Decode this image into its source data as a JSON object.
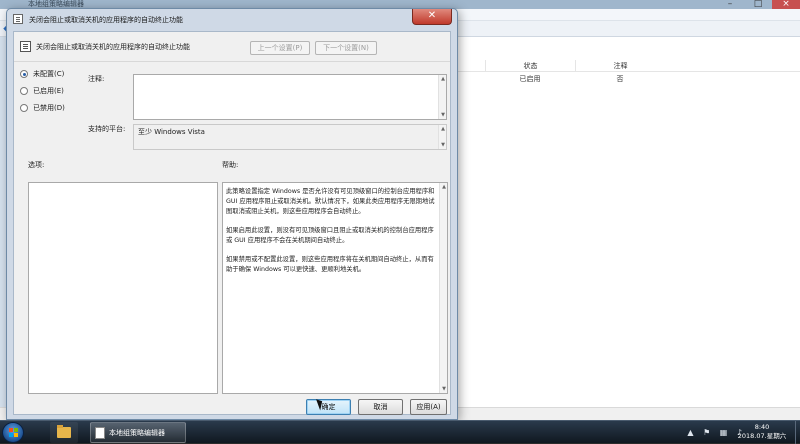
{
  "background_window": {
    "title": "本地组策略编辑器",
    "list_headers": [
      "状态",
      "注释"
    ],
    "list_row": {
      "state": "已启用",
      "comment": "否"
    }
  },
  "dialog": {
    "title": "关闭会阻止或取消关机的应用程序的自动终止功能",
    "policy_name": "关闭会阻止或取消关机的应用程序的自动终止功能",
    "prev_setting": "上一个设置(P)",
    "next_setting": "下一个设置(N)",
    "radio_options": [
      {
        "label": "未配置(C)",
        "checked": true
      },
      {
        "label": "已启用(E)",
        "checked": false
      },
      {
        "label": "已禁用(D)",
        "checked": false
      }
    ],
    "comment_label": "注释:",
    "comment_value": "",
    "supported_on_label": "支持的平台:",
    "supported_on_value": "至少 Windows Vista",
    "options_label": "选项:",
    "help_label": "帮助:",
    "help_paragraphs": [
      "此策略设置指定 Windows 是否允许没有可见顶级窗口的控制台应用程序和 GUI 应用程序阻止或取消关机。默认情况下，如果此类应用程序无限期地试图取消或阻止关机，则这些应用程序会自动终止。",
      "如果启用此设置，则没有可见顶级窗口且阻止或取消关机的控制台应用程序或 GUI 应用程序不会在关机期间自动终止。",
      "如果禁用或不配置此设置，则这些应用程序将在关机期间自动终止，从而有助于确保 Windows 可以更快速、更顺利地关机。"
    ],
    "ok_button": "确定",
    "cancel_button": "取消",
    "apply_button": "应用(A)"
  },
  "taskbar": {
    "active_app_label": "本地组策略编辑器",
    "time": "8:40",
    "date": "2018.07.星期六"
  },
  "colors": {
    "dialog_frame": "#cfd9e6",
    "client_bg": "#f0f0f0",
    "close_button": "#c0392b",
    "taskbar": "#101820"
  },
  "icons": [
    "back-arrow-icon",
    "policy-icon",
    "close-icon",
    "start-orb-icon",
    "folder-icon",
    "volume-icon",
    "network-icon",
    "flag-icon"
  ]
}
